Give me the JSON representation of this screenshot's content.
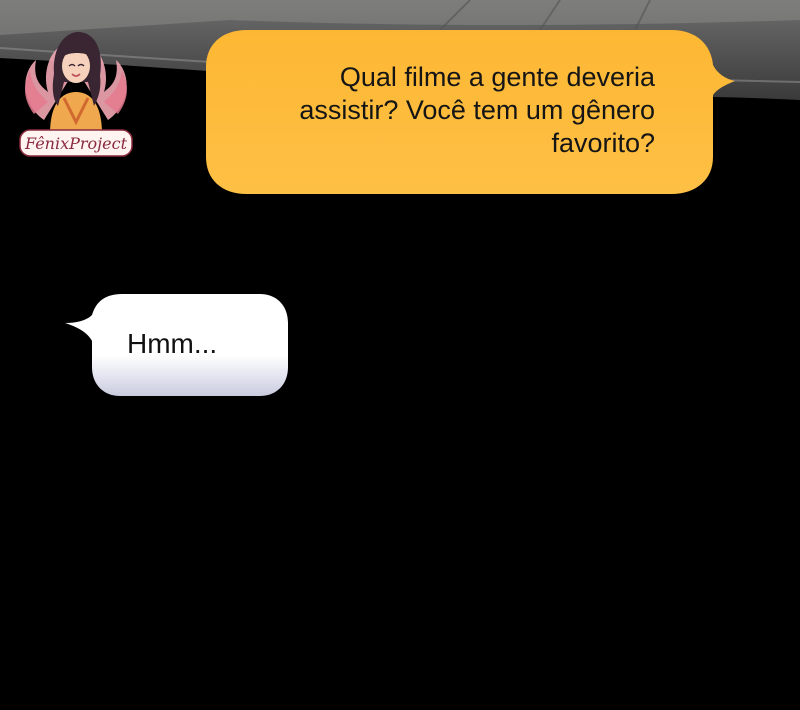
{
  "background_color": "#000000",
  "watermark": {
    "icon": "phoenix-girl-logo",
    "text": "FênixProject"
  },
  "messages": [
    {
      "side": "right",
      "text": "Qual filme a gente deveria\nassistir? Você tem um gênero\nfavorito?",
      "bubble_color": "#FDB733"
    },
    {
      "side": "left",
      "text": "Hmm...",
      "bubble_color": "#FFFFFF"
    }
  ]
}
